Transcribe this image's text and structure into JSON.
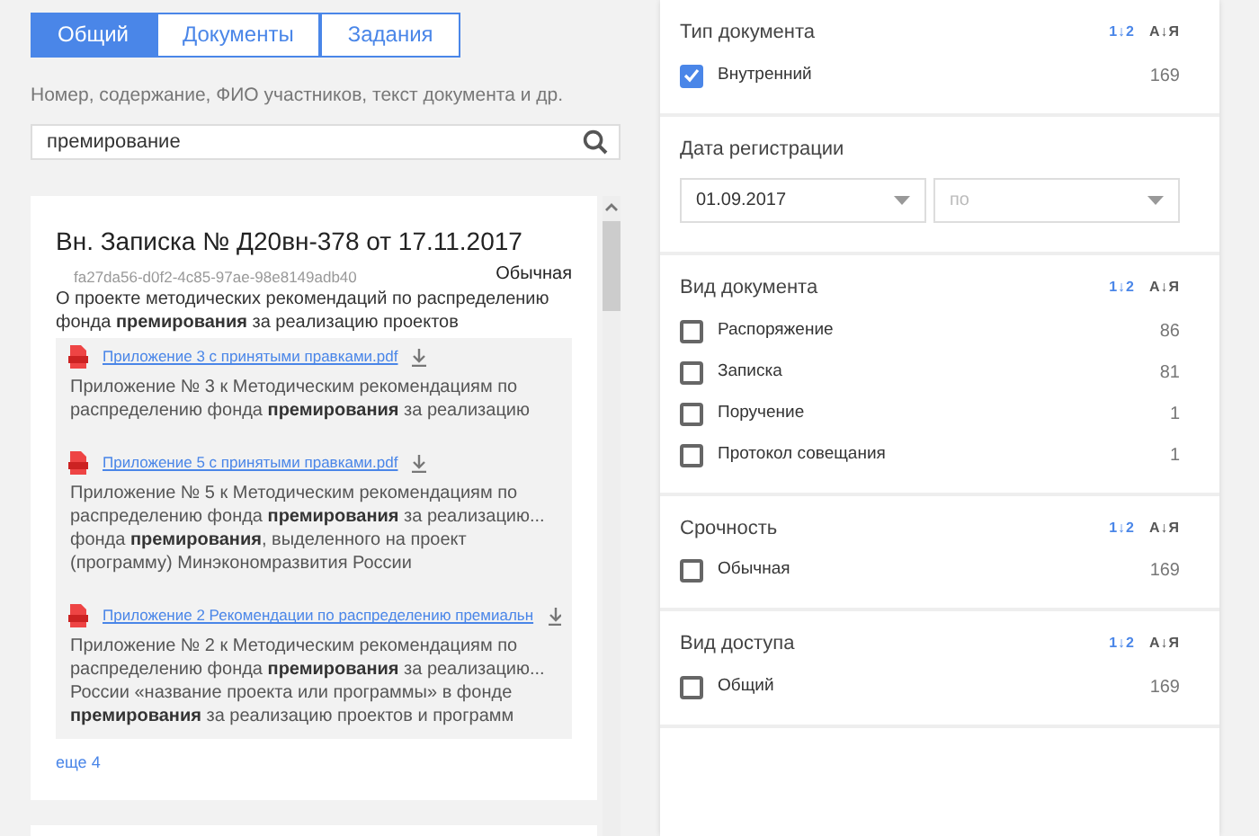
{
  "tabs": [
    {
      "label": "Общий",
      "selected": true
    },
    {
      "label": "Документы",
      "selected": false
    },
    {
      "label": "Задания",
      "selected": false
    }
  ],
  "search": {
    "label": "Номер, содержание, ФИО участников, текст документа и др.",
    "value": "премирование"
  },
  "results": [
    {
      "title": "Вн. Записка № Д20вн-378 от 17.11.2017",
      "id_text": "fa27da56-d0f2-4c85-97ae-98e8149adb40",
      "urgency": "Обычная",
      "summary": "О проекте методических рекомендаций по распределению фонда **премирования** за реализацию проектов",
      "attachments": [
        {
          "file": "Приложение 3 с принятыми правками.pdf",
          "snippet": "Приложение № 3 к Методическим рекомендациям по распределению фонда **премирования** за реализацию"
        },
        {
          "file": "Приложение 5 с принятыми правками.pdf",
          "snippet": "Приложение № 5 к Методическим рекомендациям по распределению фонда **премирования** за реализацию... фонда **премирования**, выделенного на проект (программу) Минэкономразвития России"
        },
        {
          "file": "Приложение 2 Рекомендации по распределению премиальн",
          "snippet": "Приложение № 2 к Методическим рекомендациям по распределению фонда **премирования** за реализацию... России «название проекта или программы» в фонде **премирования** за реализацию проектов и программ"
        }
      ],
      "more": "еще 4"
    }
  ],
  "filters": [
    {
      "kind": "checklist",
      "title": "Тип документа",
      "sort_options": [
        {
          "label": "1↓2",
          "selected": true
        },
        {
          "label": "А↓Я",
          "selected": false
        }
      ],
      "options": [
        {
          "label": "Внутренний",
          "count": "169",
          "checked": true
        }
      ]
    },
    {
      "kind": "date_range",
      "title": "Дата регистрации",
      "from": {
        "value": "01.09.2017"
      },
      "to": {
        "placeholder": "по"
      }
    },
    {
      "kind": "checklist",
      "title": "Вид документа",
      "sort_options": [
        {
          "label": "1↓2",
          "selected": true
        },
        {
          "label": "А↓Я",
          "selected": false
        }
      ],
      "options": [
        {
          "label": "Распоряжение",
          "count": "86",
          "checked": false
        },
        {
          "label": "Записка",
          "count": "81",
          "checked": false
        },
        {
          "label": "Поручение",
          "count": "1",
          "checked": false
        },
        {
          "label": "Протокол совещания",
          "count": "1",
          "checked": false
        }
      ]
    },
    {
      "kind": "checklist",
      "title": "Срочность",
      "sort_options": [
        {
          "label": "1↓2",
          "selected": true
        },
        {
          "label": "А↓Я",
          "selected": false
        }
      ],
      "options": [
        {
          "label": "Обычная",
          "count": "169",
          "checked": false
        }
      ]
    },
    {
      "kind": "checklist",
      "title": "Вид доступа",
      "sort_options": [
        {
          "label": "1↓2",
          "selected": true
        },
        {
          "label": "А↓Я",
          "selected": false
        }
      ],
      "options": [
        {
          "label": "Общий",
          "count": "169",
          "checked": false
        }
      ]
    }
  ]
}
